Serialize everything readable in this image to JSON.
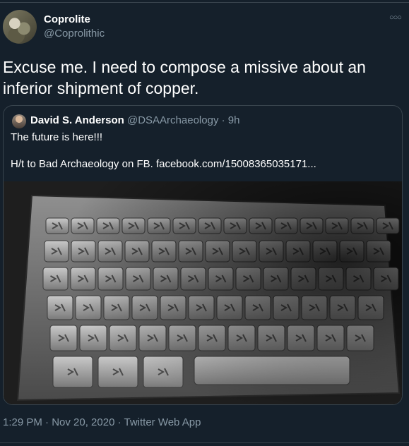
{
  "tweet": {
    "display_name": "Coprolite",
    "handle": "@Coprolithic",
    "more_icon": "more-dots-icon",
    "text": "Excuse me. I need to compose a missive about an inferior shipment of copper.",
    "timestamp": "1:29 PM · Nov 20, 2020 · Twitter Web App"
  },
  "quoted": {
    "display_name": "David S. Anderson",
    "handle": "@DSAArchaeology",
    "separator": "·",
    "age": "9h",
    "line1": "The future is here!!!",
    "line2": "H/t to Bad Archaeology on FB. facebook.com/15008365035171..."
  },
  "colors": {
    "background": "#15202b",
    "secondary_text": "#8899a6",
    "border": "#38444d"
  }
}
